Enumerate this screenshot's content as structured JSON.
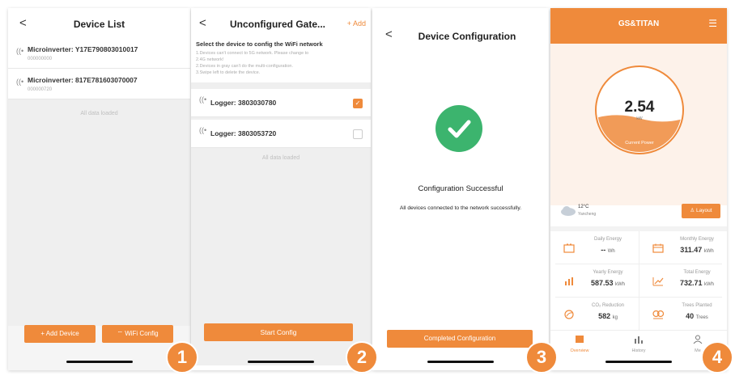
{
  "screen1": {
    "title": "Device List",
    "back": "<",
    "devices": [
      {
        "name": "Microinverter: Y17E790803010017",
        "sub": "000000000"
      },
      {
        "name": "Microinverter: 817E781603070007",
        "sub": "000000720"
      }
    ],
    "footer": "All data loaded",
    "add_device": "+ Add Device",
    "wifi_config": "WiFi Config",
    "badge": "1"
  },
  "screen2": {
    "title": "Unconfigured Gate...",
    "back": "<",
    "add": "+ Add",
    "instruction": "Select the device to config the WiFi network",
    "notes": [
      "1.Devices can't connect to 5G network. Please change to",
      "2.4G network!",
      "2.Devices in gray can't do the multi-configuration.",
      "3.Swipe left to delete the device."
    ],
    "loggers": [
      {
        "name": "Logger: 3803030780",
        "checked": true
      },
      {
        "name": "Logger: 3803053720",
        "checked": false
      }
    ],
    "footer": "All data loaded",
    "start": "Start Config",
    "badge": "2"
  },
  "screen3": {
    "title": "Device Configuration",
    "back": "<",
    "status": "Configuration Successful",
    "message": "All devices connected to the network successfully.",
    "button": "Completed Configuration",
    "badge": "3"
  },
  "screen4": {
    "title": "GS&TITAN",
    "power_value": "2.54",
    "power_unit": "kW",
    "power_label": "Current Power",
    "power_fill": 0.4,
    "weather_temp": "12°C",
    "weather_city": "Yancheng",
    "layout_btn": "Layout",
    "stats": [
      {
        "label": "Daily Energy",
        "value": "-- ",
        "unit": "Wh",
        "icon": "battery-icon"
      },
      {
        "label": "Monthly Energy",
        "value": "311.47 ",
        "unit": "kWh",
        "icon": "calendar-icon"
      },
      {
        "label": "Yearly Energy",
        "value": "587.53 ",
        "unit": "kWh",
        "icon": "bar-chart-icon"
      },
      {
        "label": "Total Energy",
        "value": "732.71 ",
        "unit": "kWh",
        "icon": "trend-icon"
      },
      {
        "label": "CO₂ Reduction",
        "value": "582 ",
        "unit": "kg",
        "icon": "leaf-icon"
      },
      {
        "label": "Trees Planted",
        "value": "40 ",
        "unit": "Trees",
        "icon": "tree-icon"
      }
    ],
    "tabs": [
      "Overview",
      "History",
      "Me"
    ],
    "badge": "4"
  },
  "colors": {
    "accent": "#ef8a3b",
    "success": "#3cb46e"
  }
}
